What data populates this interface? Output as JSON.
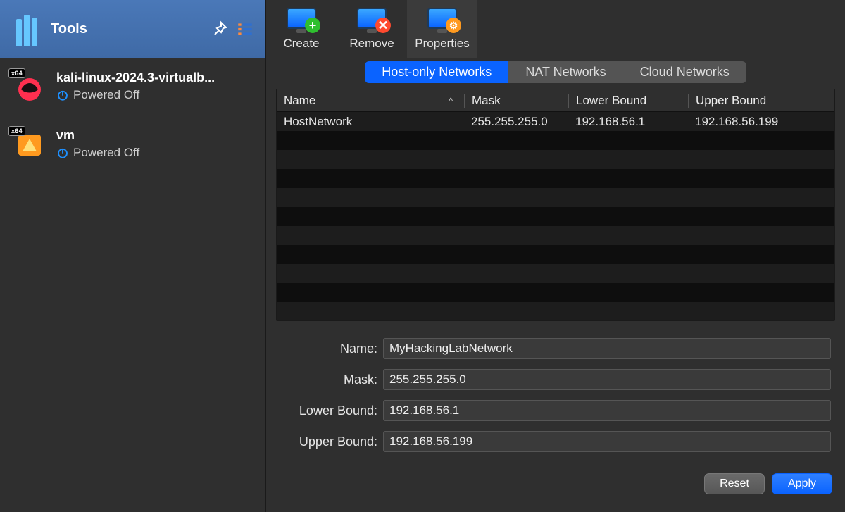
{
  "sidebar": {
    "tools_label": "Tools",
    "items": [
      {
        "name": "kali-linux-2024.3-virtualb...",
        "status": "Powered Off",
        "badge": "x64"
      },
      {
        "name": "vm",
        "status": "Powered Off",
        "badge": "x64"
      }
    ]
  },
  "toolbar": {
    "create": "Create",
    "remove": "Remove",
    "properties": "Properties"
  },
  "tabs": {
    "host_only": "Host-only Networks",
    "nat": "NAT Networks",
    "cloud": "Cloud Networks"
  },
  "table": {
    "headers": {
      "name": "Name",
      "mask": "Mask",
      "lb": "Lower Bound",
      "ub": "Upper Bound"
    },
    "rows": [
      {
        "name": "HostNetwork",
        "mask": "255.255.255.0",
        "lb": "192.168.56.1",
        "ub": "192.168.56.199"
      }
    ]
  },
  "form": {
    "name_label": "Name:",
    "mask_label": "Mask:",
    "lb_label": "Lower Bound:",
    "ub_label": "Upper Bound:",
    "name_value": "MyHackingLabNetwork",
    "mask_value": "255.255.255.0",
    "lb_value": "192.168.56.1",
    "ub_value": "192.168.56.199"
  },
  "footer": {
    "reset": "Reset",
    "apply": "Apply"
  }
}
